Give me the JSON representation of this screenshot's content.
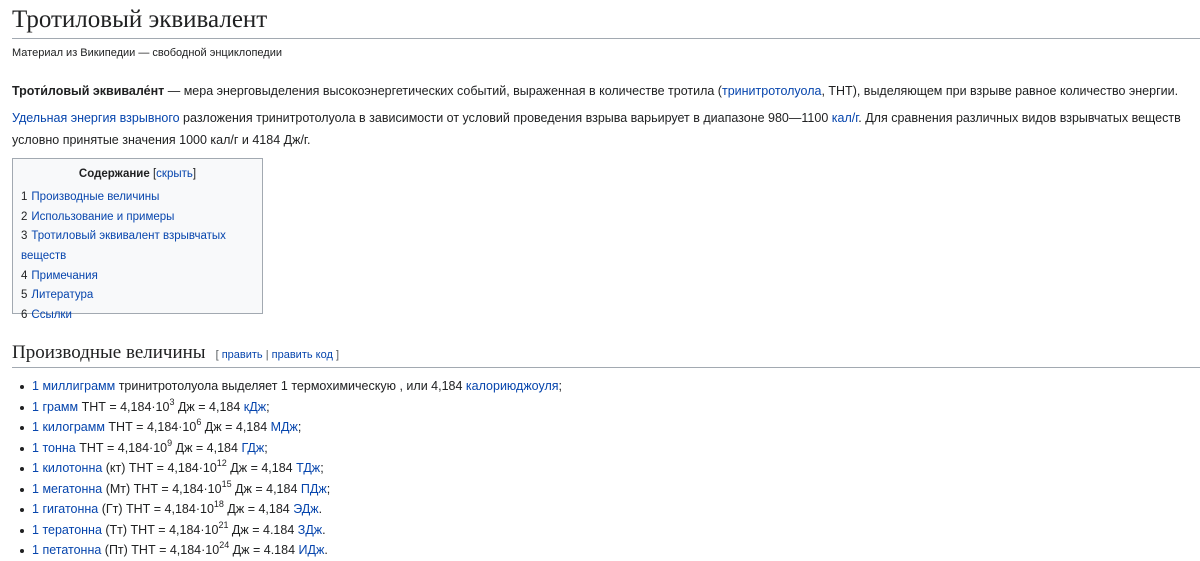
{
  "title": "Тротиловый эквивалент",
  "tagline": "Материал из Википедии — свободной энциклопедии",
  "lead": {
    "term": "Троти́ловый эквивале́нт",
    "t1": " — мера энерговыделения высокоэнергетических событий, выраженная в количестве тротила (",
    "link1": "тринитротолуола",
    "t2": ", ТНТ), выделяющем при взрыве равное количество энергии."
  },
  "para2": {
    "link1": "Удельная энергия взрывного",
    "t1": " разложения тринитротолуола в зависимости от условий проведения взрыва варьирует в диапазоне 980—1100 ",
    "link2": "кал/г",
    "t2": ". Для сравнения различных видов взрывчатых веществ условно принятые значения 1000 кал/г и 4184 Дж/г."
  },
  "toc": {
    "title": "Содержание",
    "toggle": "скрыть",
    "items": [
      {
        "num": "1",
        "label": "Производные величины"
      },
      {
        "num": "2",
        "label": "Использование и примеры"
      },
      {
        "num": "3",
        "label": "Тротиловый эквивалент взрывчатых веществ"
      },
      {
        "num": "4",
        "label": "Примечания"
      },
      {
        "num": "5",
        "label": "Литература"
      },
      {
        "num": "6",
        "label": "Ссылки"
      }
    ]
  },
  "section1": {
    "heading": "Производные величины",
    "edit": "править",
    "edit_code": "править код",
    "items": [
      {
        "num": "1",
        "link": "миллиграмм",
        "t1": " тринитротолуола выделяет 1 термохимическую ",
        "link2": "калорию",
        "t2": ", или 4,184 ",
        "link3": "джоуля",
        "t3": ";"
      },
      {
        "num": "1",
        "link": "грамм",
        "t1": " ТНТ = 4,184·10",
        "exp": "3",
        "t2": " Дж = 4,184 ",
        "link2": "кДж",
        "t3": ";"
      },
      {
        "num": "1",
        "link": "килограмм",
        "t1": " ТНТ = 4,184·10",
        "exp": "6",
        "t2": " Дж = 4,184 ",
        "link2": "МДж",
        "t3": ";"
      },
      {
        "num": "1",
        "link": "тонна",
        "t1": " ТНТ = 4,184·10",
        "exp": "9",
        "t2": " Дж = 4,184 ",
        "link2": "ГДж",
        "t3": ";"
      },
      {
        "num": "1",
        "link": "килотонна",
        "t1": " (кт) ТНТ = 4,184·10",
        "exp": "12",
        "t2": " Дж = 4,184 ",
        "link2": "ТДж",
        "t3": ";"
      },
      {
        "num": "1",
        "link": "мегатонна",
        "t1": " (Мт) ТНТ = 4,184·10",
        "exp": "15",
        "t2": " Дж = 4,184 ",
        "link2": "ПДж",
        "t3": ";"
      },
      {
        "num": "1",
        "link": "гигатонна",
        "t1": " (Гт) ТНТ = 4,184·10",
        "exp": "18",
        "t2": " Дж = 4,184 ",
        "link2": "ЭДж",
        "t3": "."
      },
      {
        "num": "1",
        "link": "тератонна",
        "t1": " (Тт) ТНТ = 4,184·10",
        "exp": "21",
        "t2": " Дж = 4.184 ",
        "link2": "ЗДж",
        "t3": "."
      },
      {
        "num": "1",
        "link": "петатонна",
        "t1": " (Пт) ТНТ = 4,184·10",
        "exp": "24",
        "t2": " Дж = 4.184 ",
        "link2": "ИДж",
        "t3": "."
      }
    ]
  }
}
